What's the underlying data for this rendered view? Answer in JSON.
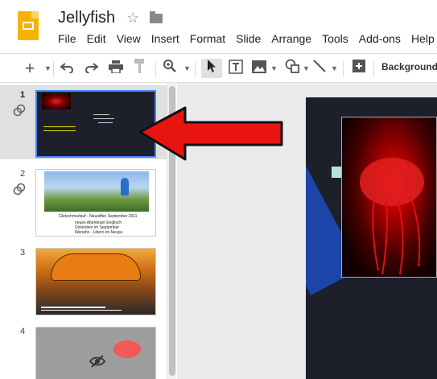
{
  "app": {
    "title": "Jellyfish",
    "menu": [
      "File",
      "Edit",
      "View",
      "Insert",
      "Format",
      "Slide",
      "Arrange",
      "Tools",
      "Add-ons",
      "Help"
    ]
  },
  "toolbar": {
    "background_label": "Background..."
  },
  "filmstrip": {
    "slides": [
      {
        "number": "1",
        "active": true,
        "linked": true
      },
      {
        "number": "2",
        "active": false,
        "linked": true,
        "text_lines": [
          "Gletschmurlauf - Neustifter September 2011",
          "neues Abenteuer Englisch",
          "Dolomiten im September",
          "Wanahs - Libero im Neuya"
        ]
      },
      {
        "number": "3",
        "active": false,
        "linked": false
      },
      {
        "number": "4",
        "active": false,
        "linked": false,
        "hidden": true
      }
    ]
  },
  "colors": {
    "accent_blue": "#4285f4",
    "logo_yellow": "#f4b400",
    "arrow_red": "#e8140f",
    "slide_dark": "#1d202b"
  }
}
